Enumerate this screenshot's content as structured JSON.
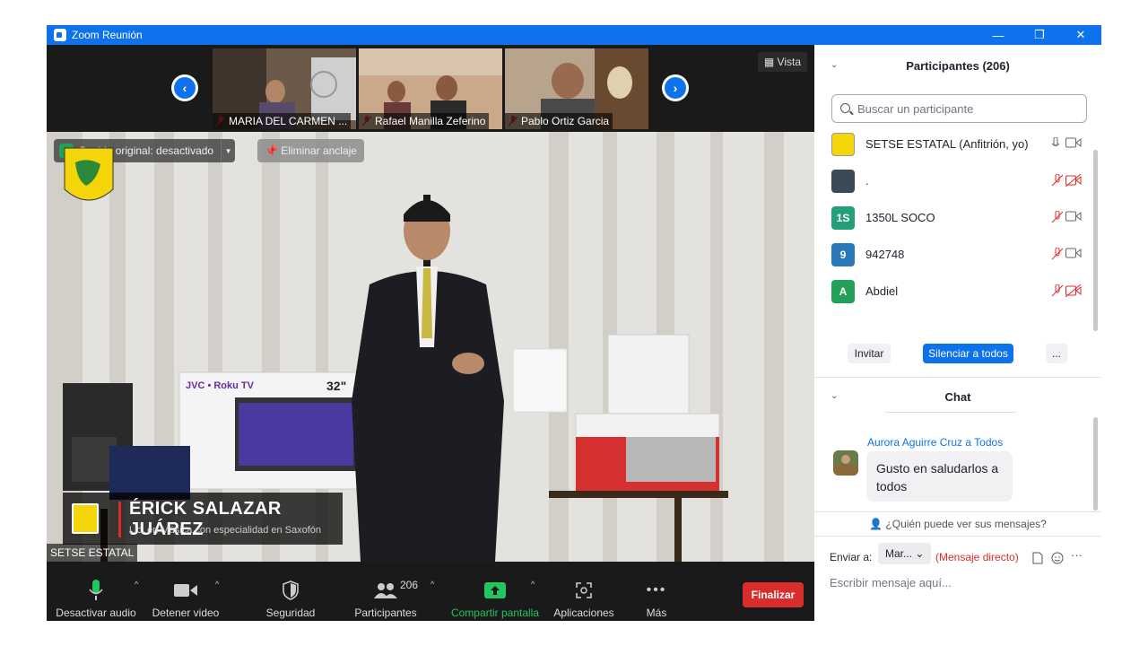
{
  "window": {
    "title": "Zoom Reunión",
    "controls": [
      "—",
      "❐",
      "✕"
    ]
  },
  "gallery": {
    "thumbnails": [
      {
        "name": "MARIA DEL CARMEN ..."
      },
      {
        "name": "Rafael Manilla Zeferino"
      },
      {
        "name": "Pablo Ortiz Garcia"
      }
    ],
    "view_label": "Vista"
  },
  "main_video": {
    "original_sound": "Sonido original: desactivado",
    "unpin": "Eliminar anclaje",
    "name_title": "ÉRICK SALAZAR JUÁREZ",
    "name_subtitle": "Lic. en Música con especialidad en Saxofón",
    "speaker_label": "SETSE ESTATAL",
    "tv_brand": "JVC • Roku TV",
    "tv_size": "32\""
  },
  "toolbar": {
    "mute": "Desactivar audio",
    "video": "Detener video",
    "security": "Seguridad",
    "participants": "Participantes",
    "participants_count": "206",
    "share": "Compartir pantalla",
    "apps": "Aplicaciones",
    "more": "Más",
    "end": "Finalizar"
  },
  "participants_panel": {
    "title": "Participantes (206)",
    "search_placeholder": "Buscar un participante",
    "list": [
      {
        "initials": "",
        "name": "SETSE ESTATAL (Anfitrión, yo)",
        "color": "#f4d50a"
      },
      {
        "initials": "",
        "name": ".",
        "color": "#3b4a55"
      },
      {
        "initials": "1S",
        "name": "1350L SOCO",
        "color": "#23a07a"
      },
      {
        "initials": "9",
        "name": "942748",
        "color": "#2a78b8"
      },
      {
        "initials": "A",
        "name": "Abdiel",
        "color": "#23a05a"
      }
    ],
    "invite": "Invitar",
    "mute_all": "Silenciar a todos",
    "more": "..."
  },
  "chat_panel": {
    "title": "Chat",
    "message": {
      "from": "Aurora Aguirre Cruz a Todos",
      "text": "Gusto en saludarlos a todos"
    },
    "who_can_see": "¿Quién puede ver sus mensajes?",
    "send_to_label": "Enviar a:",
    "recipient": "Mar...",
    "direct_message": "(Mensaje directo)",
    "input_placeholder": "Escribir mensaje aquí..."
  },
  "colors": {
    "zoom_blue": "#0e72ed",
    "end_red": "#d92d2d",
    "share_green": "#23c55e"
  }
}
